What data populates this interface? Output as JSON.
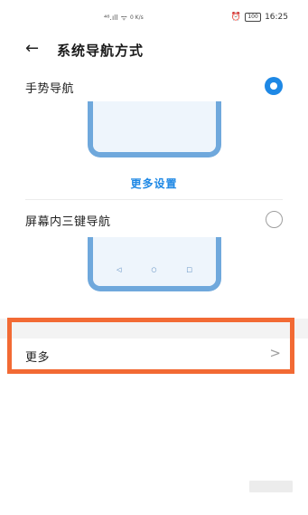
{
  "status_bar": {
    "signal": "⁴⁶.ıll",
    "wifi": "ᯤ",
    "speed": "0 K/s",
    "alarm": "⏰",
    "battery": "100",
    "time": "16:25"
  },
  "header": {
    "title": "系统导航方式"
  },
  "gesture": {
    "label": "手势导航",
    "selected": true
  },
  "more_settings": "更多设置",
  "three_key": {
    "label": "屏幕内三键导航",
    "selected": false,
    "keys": [
      "◁",
      "○",
      "□"
    ]
  },
  "more": {
    "label": "更多",
    "chevron": ">"
  },
  "colors": {
    "accent": "#1e88e5",
    "highlight": "#f26a34",
    "phone_frame": "#6fa8dc"
  }
}
